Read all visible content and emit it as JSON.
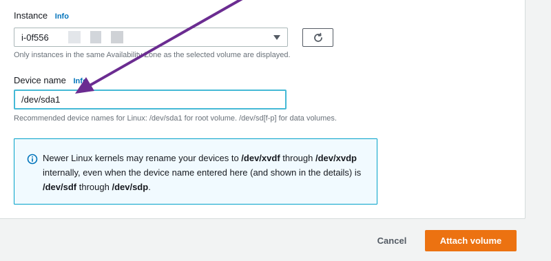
{
  "instance": {
    "label": "Instance",
    "info": "Info",
    "selected_value": "i-0f556",
    "hint": "Only instances in the same Availability Zone as the selected volume are displayed."
  },
  "device": {
    "label": "Device name",
    "info": "Info",
    "value": "/dev/sda1",
    "hint": "Recommended device names for Linux: /dev/sda1 for root volume. /dev/sd[f-p] for data volumes."
  },
  "alert": {
    "t1": "Newer Linux kernels may rename your devices to ",
    "b1": "/dev/xvdf",
    "t2": " through ",
    "b2": "/dev/xvdp",
    "t3": " internally, even when the device name entered here (and shown in the details) is ",
    "b3": "/dev/sdf",
    "t4": " through ",
    "b4": "/dev/sdp",
    "t5": "."
  },
  "footer": {
    "cancel": "Cancel",
    "attach": "Attach volume"
  },
  "colors": {
    "annotation_arrow": "#6b2c91",
    "primary_button": "#ec7211",
    "info_link": "#0073bb",
    "alert_border": "#00a1c9"
  }
}
